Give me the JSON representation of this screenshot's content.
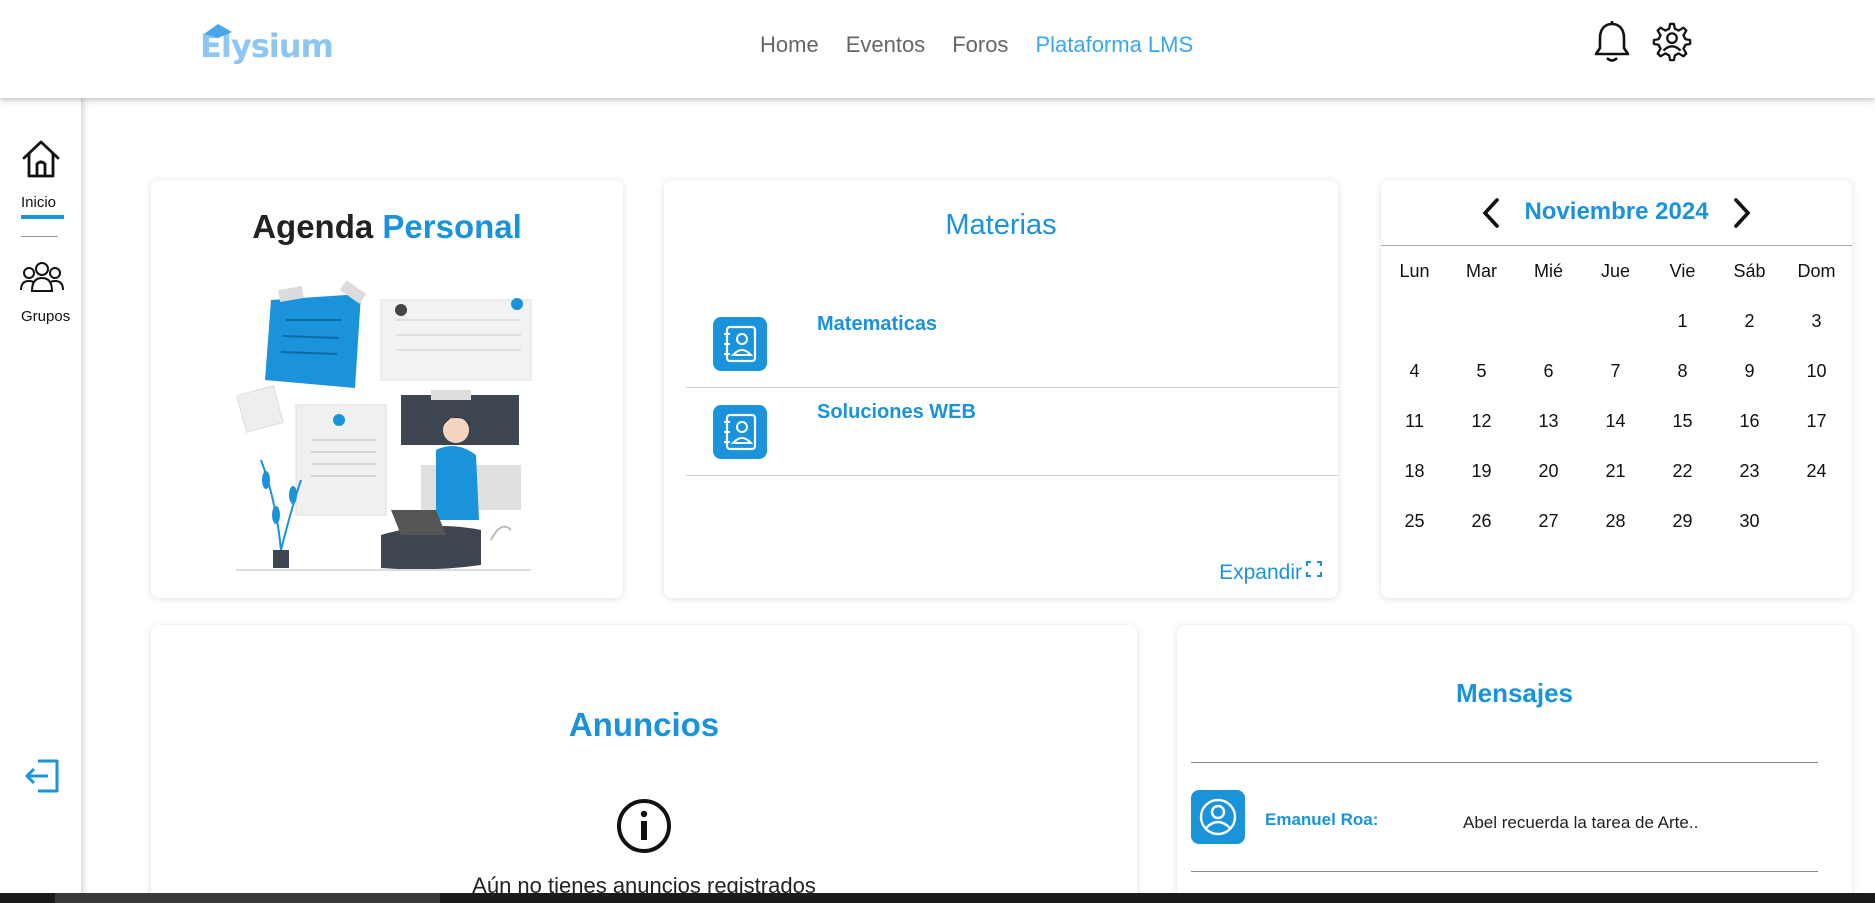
{
  "header": {
    "logo_text": "Elysium",
    "nav": [
      {
        "label": "Home",
        "active": false
      },
      {
        "label": "Eventos",
        "active": false
      },
      {
        "label": "Foros",
        "active": false
      },
      {
        "label": "Plataforma LMS",
        "active": true
      }
    ],
    "icons": [
      "bell-icon",
      "user-settings-icon"
    ]
  },
  "sidebar": {
    "items": [
      {
        "label": "Inicio",
        "icon": "home-icon",
        "active": true
      },
      {
        "label": "Grupos",
        "icon": "group-icon",
        "active": false
      }
    ],
    "logout_icon": "logout-icon"
  },
  "agenda": {
    "title_part1": "Agenda",
    "title_part2": "Personal"
  },
  "materias": {
    "title": "Materias",
    "items": [
      "Matematicas",
      "Soluciones WEB"
    ],
    "expand_label": "Expandir"
  },
  "calendar": {
    "month_label": "Noviembre 2024",
    "weekdays": [
      "Lun",
      "Mar",
      "Mié",
      "Jue",
      "Vie",
      "Sáb",
      "Dom"
    ],
    "days": [
      [
        "",
        "",
        "",
        "",
        "1",
        "2",
        "3"
      ],
      [
        "4",
        "5",
        "6",
        "7",
        "8",
        "9",
        "10"
      ],
      [
        "11",
        "12",
        "13",
        "14",
        "15",
        "16",
        "17"
      ],
      [
        "18",
        "19",
        "20",
        "21",
        "22",
        "23",
        "24"
      ],
      [
        "25",
        "26",
        "27",
        "28",
        "29",
        "30",
        ""
      ]
    ]
  },
  "anuncios": {
    "title": "Anuncios",
    "empty_text": "Aún no tienes anuncios registrados"
  },
  "mensajes": {
    "title": "Mensajes",
    "items": [
      {
        "sender": "Emanuel Roa:",
        "text": "Abel recuerda la tarea de Arte.."
      }
    ]
  },
  "colors": {
    "accent": "#1a93da",
    "nav_active": "#3aa8ee",
    "logo": "#8dc6f2"
  }
}
